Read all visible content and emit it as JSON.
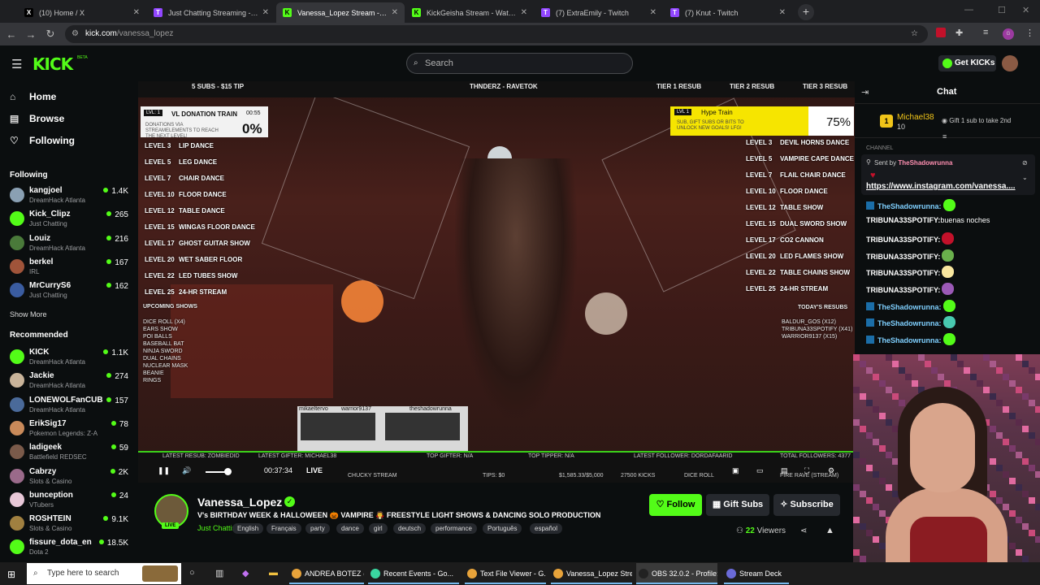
{
  "browser": {
    "tabs": [
      {
        "title": "(10) Home / X",
        "favicon": "X",
        "fav_color": "#000000",
        "active": false
      },
      {
        "title": "Just Chatting Streaming - Live",
        "favicon": "T",
        "fav_color": "#9146ff",
        "active": false
      },
      {
        "title": "Vanessa_Lopez Stream - Wa",
        "favicon": "K",
        "fav_color": "#53fc18",
        "active": true
      },
      {
        "title": "KickGeisha Stream - Watch Live",
        "favicon": "K",
        "fav_color": "#53fc18",
        "active": false
      },
      {
        "title": "(7) ExtraEmily - Twitch",
        "favicon": "T",
        "fav_color": "#9146ff",
        "active": false
      },
      {
        "title": "(7) Knut - Twitch",
        "favicon": "T",
        "fav_color": "#9146ff",
        "active": false
      }
    ],
    "url_domain": "kick.com",
    "url_path": "/vanessa_lopez"
  },
  "header": {
    "logo": "KICK",
    "search_placeholder": "Search",
    "get_kicks": "Get KICKs"
  },
  "sidebar": {
    "nav": [
      {
        "label": "Home",
        "icon": "home-icon"
      },
      {
        "label": "Browse",
        "icon": "browse-icon"
      },
      {
        "label": "Following",
        "icon": "heart-icon"
      }
    ],
    "following_title": "Following",
    "following": [
      {
        "name": "kangjoel",
        "category": "DreamHack Atlanta",
        "viewers": "1.4K",
        "color": "#8aa0b3"
      },
      {
        "name": "Kick_Clipz",
        "category": "Just Chatting",
        "viewers": "265",
        "color": "#53fc18"
      },
      {
        "name": "Louiz",
        "category": "DreamHack Atlanta",
        "viewers": "216",
        "color": "#4a7a3a"
      },
      {
        "name": "berkel",
        "category": "IRL",
        "viewers": "167",
        "color": "#a0543a"
      },
      {
        "name": "MrCurryS6",
        "category": "Just Chatting",
        "viewers": "162",
        "color": "#3a5ca0"
      }
    ],
    "show_more": "Show More",
    "recommended_title": "Recommended",
    "recommended": [
      {
        "name": "KICK",
        "category": "DreamHack Atlanta",
        "viewers": "1.1K",
        "color": "#53fc18"
      },
      {
        "name": "Jackie",
        "category": "DreamHack Atlanta",
        "viewers": "274",
        "color": "#c9b49a"
      },
      {
        "name": "LONEWOLFanCUB",
        "category": "DreamHack Atlanta",
        "viewers": "157",
        "color": "#4a6a9a"
      },
      {
        "name": "ErikSig17",
        "category": "Pokemon Legends: Z-A",
        "viewers": "78",
        "color": "#c98a5a"
      },
      {
        "name": "ladigeek",
        "category": "Battlefield REDSEC",
        "viewers": "59",
        "color": "#7a5a4a"
      },
      {
        "name": "Cabrzy",
        "category": "Slots & Casino",
        "viewers": "2K",
        "color": "#9a6a8a"
      },
      {
        "name": "bunception",
        "category": "VTubers",
        "viewers": "24",
        "color": "#e8c8d8"
      },
      {
        "name": "ROSHTEIN",
        "category": "Slots & Casino",
        "viewers": "9.1K",
        "color": "#a08040"
      },
      {
        "name": "fissure_dota_en",
        "category": "Dota 2",
        "viewers": "18.5K",
        "color": "#53fc18"
      }
    ]
  },
  "overlay": {
    "top_items": [
      "5 SUBS - $15 TIP",
      "THNDERZ - RAVETOK",
      "TIER 1 RESUB",
      "TIER 2 RESUB",
      "TIER 3 RESUB"
    ],
    "donation_train": {
      "level": "LVL: 1",
      "title": "VL DONATION TRAIN",
      "time": "00:55",
      "subtitle": "DONATIONS VIA STREAMELEMENTS TO REACH THE NEXT LEVEL!",
      "percent": "0%"
    },
    "hype_train": {
      "level": "LVL 1",
      "title": "Hype Train",
      "subtitle": "SUB, GIFT SUBS OR BITS TO UNLOCK NEW GOALS! LFG!",
      "percent": "75%",
      "progress": 0.75
    },
    "left_levels": [
      {
        "lvl": "LEVEL 3",
        "goal": "LIP DANCE"
      },
      {
        "lvl": "LEVEL 5",
        "goal": "LEG DANCE"
      },
      {
        "lvl": "LEVEL 7",
        "goal": "CHAIR DANCE"
      },
      {
        "lvl": "LEVEL 10",
        "goal": "FLOOR DANCE"
      },
      {
        "lvl": "LEVEL 12",
        "goal": "TABLE DANCE"
      },
      {
        "lvl": "LEVEL 15",
        "goal": "WINGAS FLOOR DANCE"
      },
      {
        "lvl": "LEVEL 17",
        "goal": "GHOST GUITAR SHOW"
      },
      {
        "lvl": "LEVEL 20",
        "goal": "WET SABER FLOOR"
      },
      {
        "lvl": "LEVEL 22",
        "goal": "LED TUBES SHOW"
      },
      {
        "lvl": "LEVEL 25",
        "goal": "24-HR STREAM"
      }
    ],
    "right_levels": [
      {
        "lvl": "LEVEL 3",
        "goal": "DEVIL HORNS DANCE"
      },
      {
        "lvl": "LEVEL 5",
        "goal": "VAMPIRE CAPE DANCE"
      },
      {
        "lvl": "LEVEL 7",
        "goal": "FLAIL CHAIR DANCE"
      },
      {
        "lvl": "LEVEL 10",
        "goal": "FLOOR DANCE"
      },
      {
        "lvl": "LEVEL 12",
        "goal": "TABLE SHOW"
      },
      {
        "lvl": "LEVEL 15",
        "goal": "DUAL SWORD SHOW"
      },
      {
        "lvl": "LEVEL 17",
        "goal": "CO2 CANNON"
      },
      {
        "lvl": "LEVEL 20",
        "goal": "LED FLAMES SHOW"
      },
      {
        "lvl": "LEVEL 22",
        "goal": "TABLE CHAINS SHOW"
      },
      {
        "lvl": "LEVEL 25",
        "goal": "24-HR STREAM"
      }
    ],
    "upcoming_title": "UPCOMING SHOWS",
    "upcoming": "DICE ROLL (X4)\nEARS SHOW\nPOI BALLS\nBASEBALL BAT\nNINJA SWORD\nDUAL CHAINS\nNUCLEAR MASK\nBEANIE\nRINGS",
    "resubs_title": "TODAY'S RESUBS",
    "resubs": "BALDUR_GOS (X12)\nTRIBUNA33SPOTIFY (X41)\nWARRIOR9137 (X15)",
    "cam_labels": [
      "mikaeltervo",
      "warrior9137",
      "theshadowrunna"
    ],
    "ticker": [
      "LATEST RESUB: ZOMBIEDID",
      "LATEST GIFTER: MICHAEL38",
      "TOP GIFTER: N/A",
      "TOP TIPPER: N/A",
      "LATEST FOLLOWER: DORDAFAARID",
      "TOTAL FOLLOWERS: 4377"
    ],
    "ticker2": [
      "CHUCKY STREAM",
      "TIPS: $0",
      "$1,585.33/$5,000",
      "27500 KICKS",
      "DICE ROLL",
      "FIRE RAVE (STREAM)"
    ],
    "time": "00:37:34",
    "live": "LIVE"
  },
  "channel": {
    "name": "Vanessa_Lopez",
    "live_tag": "LIVE",
    "title": "V's BIRTHDAY WEEK & HALLOWEEN 🎃 VAMPIRE 🧛 FREESTYLE LIGHT SHOWS & DANCING SOLO PRODUCTION",
    "category": "Just Chatting",
    "tags": [
      "English",
      "Français",
      "party",
      "dance",
      "girl",
      "deutsch",
      "performance",
      "Português",
      "español"
    ],
    "follow": "Follow",
    "gift_subs": "Gift Subs",
    "subscribe": "Subscribe",
    "viewers_count": "22",
    "viewers_label": "Viewers"
  },
  "chat": {
    "title": "Chat",
    "top_gifter": {
      "rank": "1",
      "name": "Michael38",
      "count": "10",
      "gift_text": "Gift 1 sub to take 2nd"
    },
    "channel_label": "CHANNEL",
    "pinned": {
      "sent_by_label": "Sent by",
      "sender": "TheShadowrunna",
      "link": "https://www.instagram.com/vanessa...."
    },
    "messages": [
      {
        "user": "TheShadowrunna:",
        "text": "",
        "color": "#7fd0ff",
        "icon": true,
        "emote": "#53fc18"
      },
      {
        "user": "TRIBUNA33SPOTIFY:",
        "text": "buenas noches",
        "color": "#ffffff",
        "icon": false,
        "emote": ""
      },
      {
        "user": "TRIBUNA33SPOTIFY:",
        "text": "",
        "color": "#ffffff",
        "icon": false,
        "emote": "#c2112a"
      },
      {
        "user": "TRIBUNA33SPOTIFY:",
        "text": "",
        "color": "#ffffff",
        "icon": false,
        "emote": "#6ab04c"
      },
      {
        "user": "TRIBUNA33SPOTIFY:",
        "text": "",
        "color": "#ffffff",
        "icon": false,
        "emote": "#f9e79f"
      },
      {
        "user": "TRIBUNA33SPOTIFY:",
        "text": "",
        "color": "#ffffff",
        "icon": false,
        "emote": "#9b59b6"
      },
      {
        "user": "TheShadowrunna:",
        "text": "",
        "color": "#7fd0ff",
        "icon": true,
        "emote": "#53fc18"
      },
      {
        "user": "TheShadowrunna:",
        "text": "",
        "color": "#7fd0ff",
        "icon": true,
        "emote": "#48c9b0"
      },
      {
        "user": "TheShadowrunna:",
        "text": "",
        "color": "#7fd0ff",
        "icon": true,
        "emote": "#53fc18"
      }
    ]
  },
  "taskbar": {
    "search_placeholder": "Type here to search",
    "apps": [
      {
        "label": "ANDREA BOTEZ @ ...",
        "color": "#e8a33a"
      },
      {
        "label": "Recent Events - Go...",
        "color": "#3ad6a0"
      },
      {
        "label": "Text File Viewer - G...",
        "color": "#e8a33a"
      },
      {
        "label": "Vanessa_Lopez Stre...",
        "color": "#e8a33a"
      },
      {
        "label": "OBS 32.0.2 - Profile:...",
        "color": "#222222"
      },
      {
        "label": "Stream Deck",
        "color": "#6a6ad8"
      }
    ]
  }
}
